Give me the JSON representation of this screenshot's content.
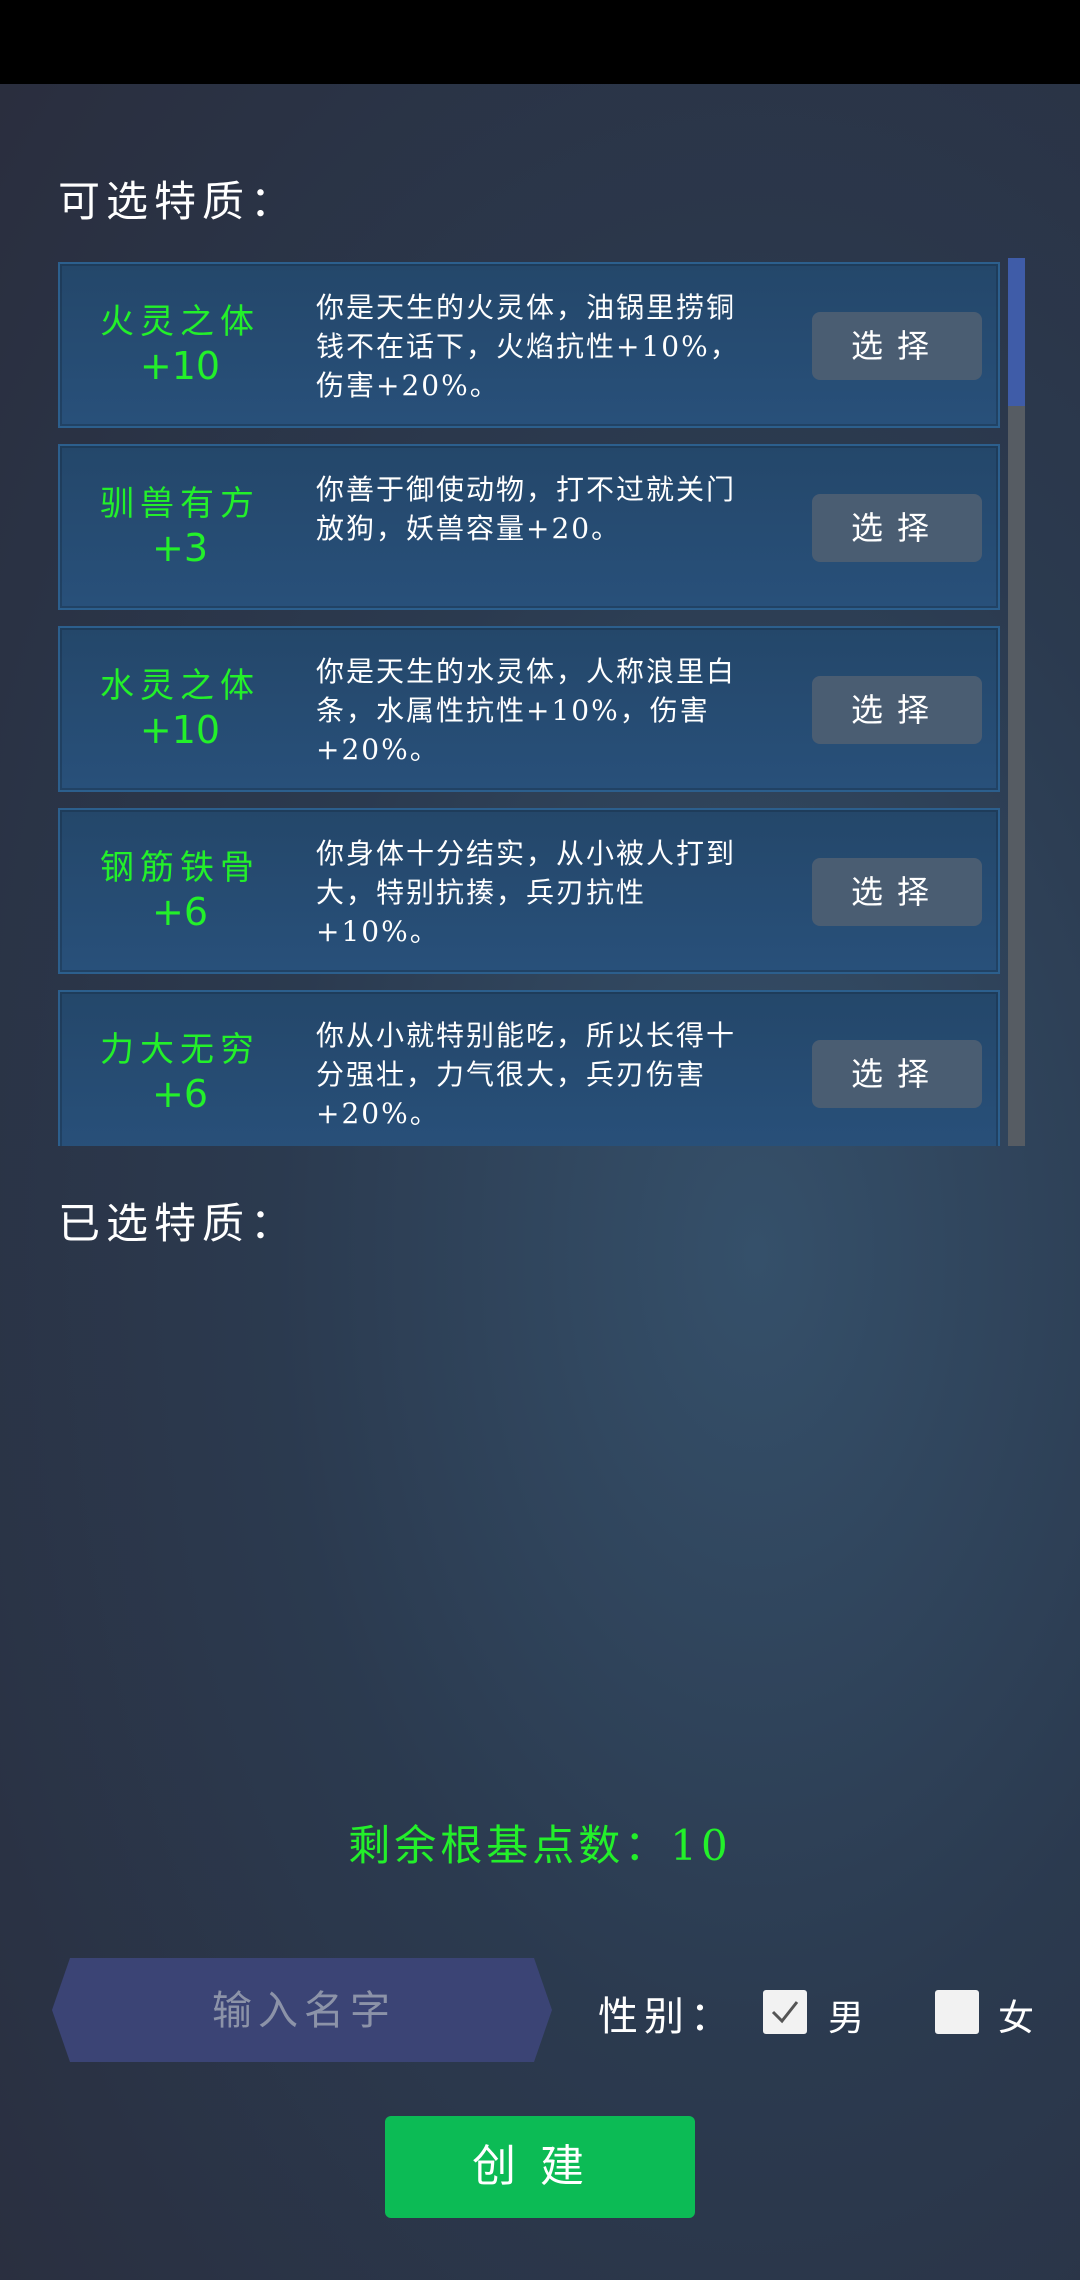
{
  "available_title": "可选特质：",
  "selected_title": "已选特质：",
  "traits": [
    {
      "name": "火灵之体",
      "cost": "+10",
      "desc": "你是天生的火灵体，油锅里捞铜钱不在话下，火焰抗性+10%，伤害+20%。",
      "button": "选择"
    },
    {
      "name": "驯兽有方",
      "cost": "+3",
      "desc": "你善于御使动物，打不过就关门放狗，妖兽容量+20。",
      "button": "选择"
    },
    {
      "name": "水灵之体",
      "cost": "+10",
      "desc": "你是天生的水灵体，人称浪里白条，水属性抗性+10%，伤害+20%。",
      "button": "选择"
    },
    {
      "name": "钢筋铁骨",
      "cost": "+6",
      "desc": "你身体十分结实，从小被人打到大，特别抗揍，兵刃抗性+10%。",
      "button": "选择"
    },
    {
      "name": "力大无穷",
      "cost": "+6",
      "desc": "你从小就特别能吃，所以长得十分强壮，力气很大，兵刃伤害+20%。",
      "button": "选择"
    }
  ],
  "points": {
    "label": "剩余根基点数：",
    "value": "10"
  },
  "name_input": {
    "placeholder": "输入名字",
    "value": ""
  },
  "gender": {
    "label": "性别：",
    "options": [
      {
        "label": "男",
        "checked": true
      },
      {
        "label": "女",
        "checked": false
      }
    ]
  },
  "create_button": "创建",
  "colors": {
    "accent_green": "#23f02a",
    "card_border": "#2c5f8d",
    "button_gray": "#4a5d72",
    "create_green": "#0cbb55",
    "input_purple": "#3b4475"
  }
}
